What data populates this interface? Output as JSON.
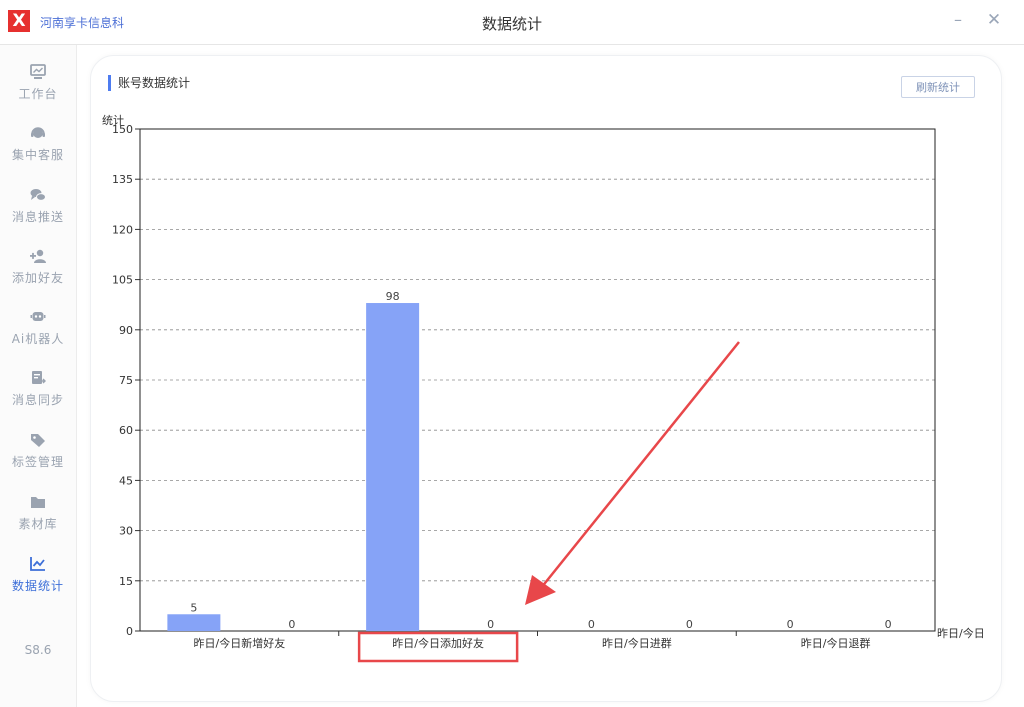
{
  "window": {
    "company": "河南享卡信息科",
    "title": "数据统计",
    "minimize_glyph": "–",
    "close_glyph": "✕"
  },
  "sidebar": {
    "items": [
      {
        "label": "工作台",
        "icon": "monitor-icon",
        "active": false
      },
      {
        "label": "集中客服",
        "icon": "headset-icon",
        "active": false
      },
      {
        "label": "消息推送",
        "icon": "chat-bubbles-icon",
        "active": false
      },
      {
        "label": "添加好友",
        "icon": "add-user-icon",
        "active": false
      },
      {
        "label": "Ai机器人",
        "icon": "robot-icon",
        "active": false
      },
      {
        "label": "消息同步",
        "icon": "sync-document-icon",
        "active": false
      },
      {
        "label": "标签管理",
        "icon": "tag-icon",
        "active": false
      },
      {
        "label": "素材库",
        "icon": "folder-icon",
        "active": false
      },
      {
        "label": "数据统计",
        "icon": "line-chart-icon",
        "active": true
      }
    ],
    "version": "S8.6"
  },
  "section": {
    "title": "账号数据统计",
    "refresh_label": "刷新统计"
  },
  "colors": {
    "accent": "#3d6fd8",
    "bar": "#86a3f7",
    "annotation": "#e8474a",
    "logo": "#e6302f"
  },
  "chart_data": {
    "type": "bar",
    "ylabel": "统计",
    "xlabel": "昨日/今日",
    "ylim": [
      0,
      150
    ],
    "yticks": [
      0,
      15,
      30,
      45,
      60,
      75,
      90,
      105,
      120,
      135,
      150
    ],
    "grid": true,
    "categories": [
      "昨日/今日新增好友",
      "昨日/今日添加好友",
      "昨日/今日进群",
      "昨日/今日退群"
    ],
    "series": [
      {
        "values": [
          5,
          98,
          0,
          0
        ]
      },
      {
        "values": [
          0,
          0,
          0,
          0
        ]
      }
    ]
  },
  "annotation": {
    "highlighted_category": "昨日/今日添加好友"
  }
}
